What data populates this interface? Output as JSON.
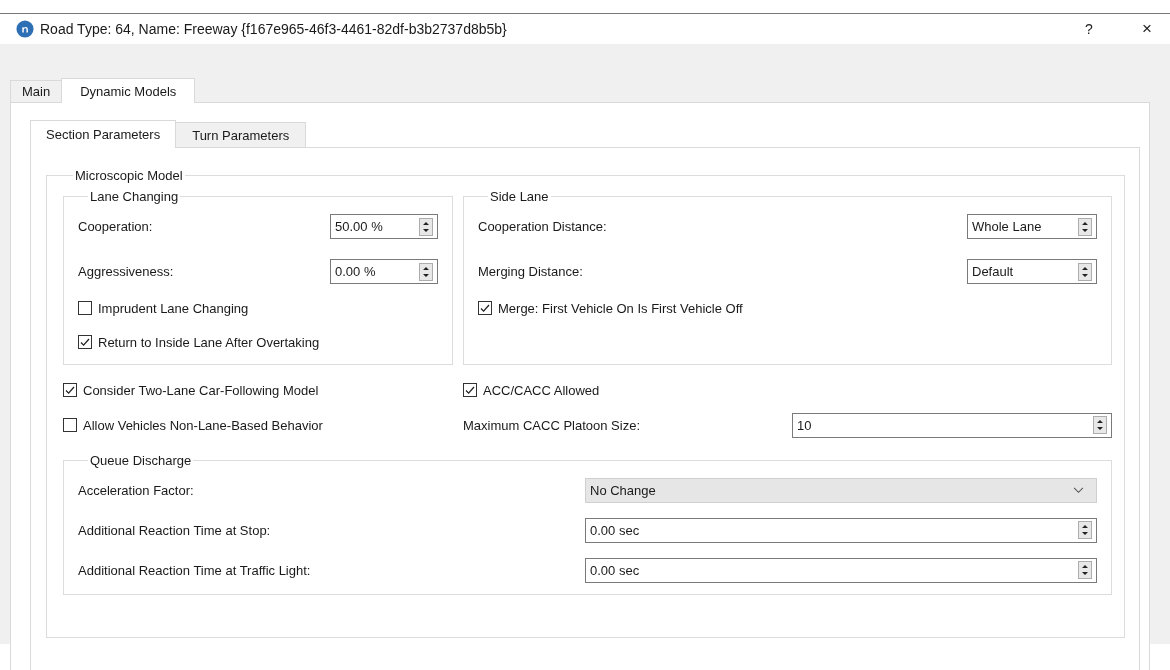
{
  "window": {
    "title": "Road Type: 64, Name: Freeway  {f167e965-46f3-4461-82df-b3b2737d8b5b}",
    "help": "?",
    "close": "×"
  },
  "tabs": [
    {
      "label": "Main",
      "selected": false
    },
    {
      "label": "Dynamic Models",
      "selected": true
    }
  ],
  "subtabs": [
    {
      "label": "Section Parameters",
      "selected": true
    },
    {
      "label": "Turn Parameters",
      "selected": false
    }
  ],
  "microscopic_model": {
    "title": "Microscopic Model",
    "lane_changing": {
      "title": "Lane Changing",
      "fields": [
        {
          "label": "Cooperation:",
          "value": "50.00 %"
        },
        {
          "label": "Aggressiveness:",
          "value": "0.00 %"
        }
      ],
      "checkboxes": [
        {
          "label": "Imprudent Lane Changing",
          "checked": false
        },
        {
          "label": "Return to Inside Lane After Overtaking",
          "checked": true
        }
      ]
    },
    "side_lane": {
      "title": "Side Lane",
      "fields": [
        {
          "label": "Cooperation Distance:",
          "value": "Whole Lane"
        },
        {
          "label": "Merging Distance:",
          "value": "Default"
        }
      ],
      "checkboxes": [
        {
          "label": "Merge: First Vehicle On Is First Vehicle Off",
          "checked": true
        }
      ]
    },
    "left_options": [
      {
        "label": "Consider Two-Lane Car-Following Model",
        "checked": true
      },
      {
        "label": "Allow Vehicles Non-Lane-Based Behavior",
        "checked": false
      }
    ],
    "acc_cacc": {
      "label": "ACC/CACC Allowed",
      "checked": true
    },
    "platoon": {
      "label": "Maximum CACC Platoon Size:",
      "value": "10"
    },
    "queue_discharge": {
      "title": "Queue Discharge",
      "rows": [
        {
          "kind": "dropdown",
          "label": "Acceleration Factor:",
          "value": "No Change"
        },
        {
          "kind": "spin",
          "label": "Additional Reaction Time at Stop:",
          "value": "0.00 sec"
        },
        {
          "kind": "spin",
          "label": "Additional Reaction Time at Traffic Light:",
          "value": "0.00 sec"
        }
      ]
    }
  }
}
